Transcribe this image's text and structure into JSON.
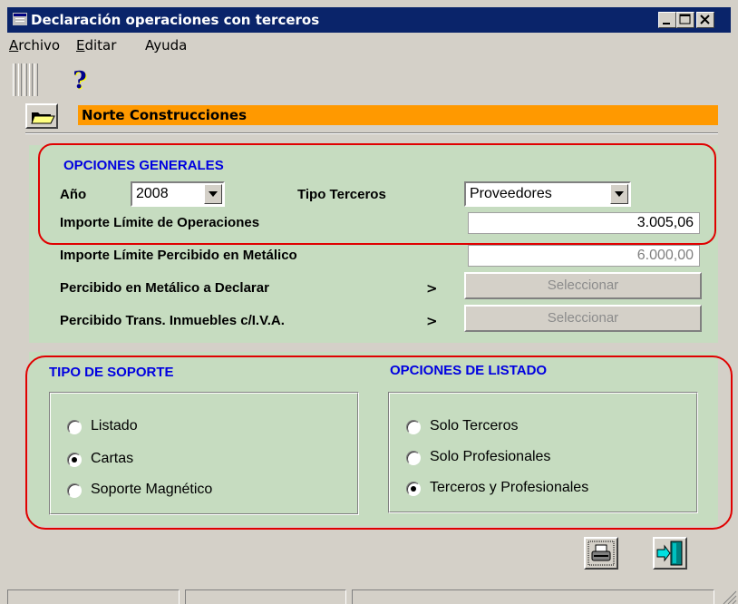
{
  "window": {
    "title": "Declaración operaciones con terceros"
  },
  "menu": {
    "archivo": {
      "first": "A",
      "rest": "rchivo"
    },
    "editar": {
      "first": "E",
      "rest": "ditar"
    },
    "ayuda": "Ayuda"
  },
  "toolbar": {
    "help_icon": "help-icon"
  },
  "company": {
    "name": "Norte Construcciones"
  },
  "general": {
    "heading": "OPCIONES GENERALES",
    "year_label": "Año",
    "year_value": "2008",
    "tipo_label": "Tipo Terceros",
    "tipo_value": "Proveedores",
    "importe_limite_label": "Importe Límite de Operaciones",
    "importe_limite_value": "3.005,06",
    "importe_metalico_label": "Importe Límite Percibido en Metálico",
    "importe_metalico_value": "6.000,00",
    "percibido_label": "Percibido en Metálico a Declarar",
    "percibido_arrow": ">",
    "percibido_button": "Seleccionar",
    "inmuebles_label": "Percibido Trans. Inmuebles c/I.V.A.",
    "inmuebles_arrow": ">",
    "inmuebles_button": "Seleccionar"
  },
  "soporte": {
    "heading": "TIPO DE SOPORTE",
    "options": [
      {
        "label": "Listado",
        "checked": false
      },
      {
        "label": "Cartas",
        "checked": true
      },
      {
        "label": "Soporte Magnético",
        "checked": false
      }
    ]
  },
  "listado": {
    "heading": "OPCIONES DE LISTADO",
    "options": [
      {
        "label": "Solo Terceros",
        "checked": false
      },
      {
        "label": "Solo Profesionales",
        "checked": false
      },
      {
        "label": "Terceros y Profesionales",
        "checked": true
      }
    ]
  },
  "actions": {
    "print_icon": "printer-icon",
    "exit_icon": "exit-door-icon"
  },
  "colors": {
    "title_bar": "#0a246a",
    "company_bar": "#ff9900",
    "panel": "#c6dcc0",
    "heading": "#0000e0",
    "highlight": "#e00000"
  }
}
